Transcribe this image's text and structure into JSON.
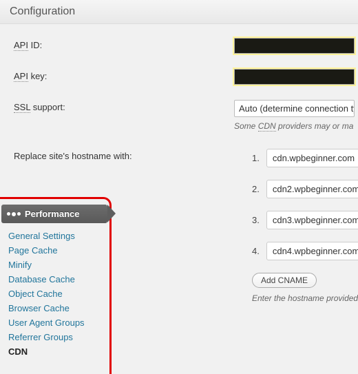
{
  "header": {
    "title": "Configuration"
  },
  "fields": {
    "api_id_label": "API ID:",
    "api_id_abbr": "API",
    "api_key_label": "API key:",
    "ssl_label": "SSL support:",
    "ssl_abbr": "SSL",
    "ssl_value": "Auto (determine connection typ",
    "ssl_note_pre": "Some ",
    "ssl_note_abbr": "CDN",
    "ssl_note_post": " providers may or ma",
    "replace_label": "Replace site's hostname with:"
  },
  "hostnames": {
    "items": [
      {
        "num": "1.",
        "value": "cdn.wpbeginner.com"
      },
      {
        "num": "2.",
        "value": "cdn2.wpbeginner.com"
      },
      {
        "num": "3.",
        "value": "cdn3.wpbeginner.com"
      },
      {
        "num": "4.",
        "value": "cdn4.wpbeginner.com"
      }
    ],
    "add_label": "Add CNAME",
    "enter_note": "Enter the hostname provided by"
  },
  "sidebar": {
    "title": "Performance",
    "items": [
      {
        "label": "General Settings"
      },
      {
        "label": "Page Cache"
      },
      {
        "label": "Minify"
      },
      {
        "label": "Database Cache"
      },
      {
        "label": "Object Cache"
      },
      {
        "label": "Browser Cache"
      },
      {
        "label": "User Agent Groups"
      },
      {
        "label": "Referrer Groups"
      },
      {
        "label": "CDN"
      }
    ]
  }
}
